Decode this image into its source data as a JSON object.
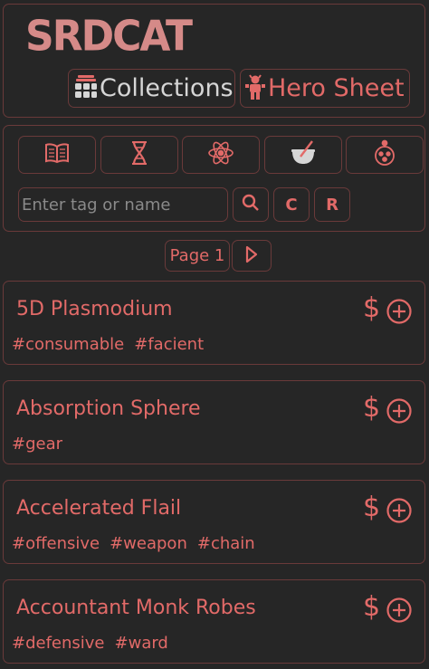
{
  "app": {
    "logo": "SRDCAT",
    "nav": {
      "collections_label": "Collections",
      "hero_sheet_label": "Hero Sheet"
    }
  },
  "filters": {
    "categories": [
      {
        "icon": "book-icon"
      },
      {
        "icon": "dna-icon"
      },
      {
        "icon": "atom-icon"
      },
      {
        "icon": "cauldron-icon"
      },
      {
        "icon": "jester-face-icon"
      }
    ],
    "search": {
      "placeholder": "Enter tag or name",
      "value": ""
    },
    "clear_label": "C",
    "random_label": "R"
  },
  "pagination": {
    "page_label": "Page 1"
  },
  "items": [
    {
      "name": "5D Plasmodium",
      "tags": [
        "#consumable",
        "#facient"
      ]
    },
    {
      "name": "Absorption Sphere",
      "tags": [
        "#gear"
      ]
    },
    {
      "name": "Accelerated Flail",
      "tags": [
        "#offensive",
        "#weapon",
        "#chain"
      ]
    },
    {
      "name": "Accountant Monk Robes",
      "tags": [
        "#defensive",
        "#ward"
      ]
    }
  ],
  "item_actions": {
    "price_symbol": "$"
  },
  "colors": {
    "background": "#262626",
    "accent": "#e26a68",
    "border": "#6a3a3a",
    "logo": "#d58a88"
  }
}
